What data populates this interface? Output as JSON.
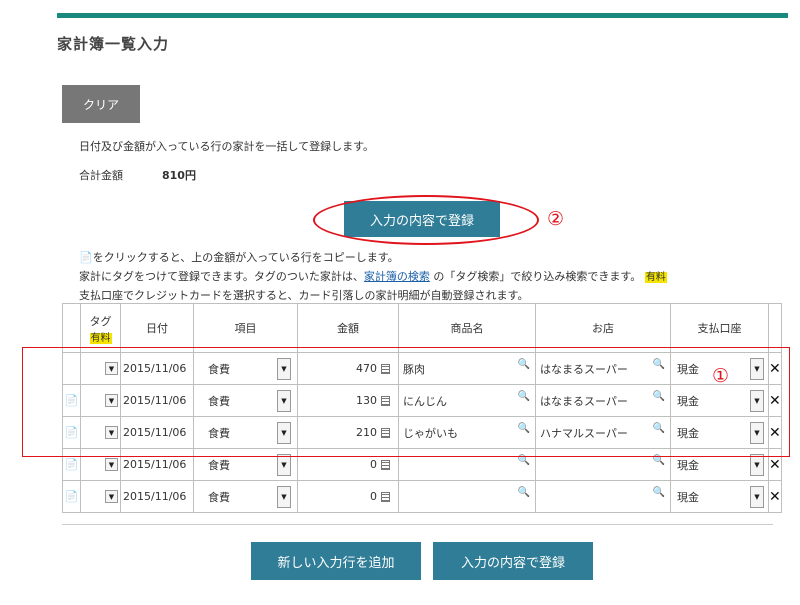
{
  "page": {
    "title": "家計簿一覧入力"
  },
  "buttons": {
    "clear": "クリア",
    "register": "入力の内容で登録",
    "add_row": "新しい入力行を追加",
    "register_bottom": "入力の内容で登録"
  },
  "info": {
    "bulk_note": "日付及び金額が入っている行の家計を一括して登録します。",
    "total_label": "合計金額",
    "total_value": "810円"
  },
  "notes": {
    "copy_note": "をクリックすると、上の金額が入っている行をコピーします。",
    "tag_note_prefix": "家計にタグをつけて登録できます。タグのついた家計は、",
    "tag_note_link": "家計簿の検索",
    "tag_note_suffix": " の「タグ検索」で絞り込み検索できます。",
    "paid_badge": "有料",
    "card_note": "支払口座でクレジットカードを選択すると、カード引落しの家計明細が自動登録されます。"
  },
  "annotations": {
    "marker1": "①",
    "marker2": "②"
  },
  "table": {
    "headers": {
      "tag": "タグ",
      "tag_badge": "有料",
      "date": "日付",
      "item": "項目",
      "amount": "金額",
      "product": "商品名",
      "shop": "お店",
      "account": "支払口座"
    },
    "rows": [
      {
        "date": "2015/11/06",
        "item": "食費",
        "amount": "470",
        "product": "豚肉",
        "shop": "はなまるスーパー",
        "account": "現金"
      },
      {
        "date": "2015/11/06",
        "item": "食費",
        "amount": "130",
        "product": "にんじん",
        "shop": "はなまるスーパー",
        "account": "現金"
      },
      {
        "date": "2015/11/06",
        "item": "食費",
        "amount": "210",
        "product": "じゃがいも",
        "shop": "ハナマルスーパー",
        "account": "現金"
      },
      {
        "date": "2015/11/06",
        "item": "食費",
        "amount": "0",
        "product": "",
        "shop": "",
        "account": "現金"
      },
      {
        "date": "2015/11/06",
        "item": "食費",
        "amount": "0",
        "product": "",
        "shop": "",
        "account": "現金"
      }
    ]
  },
  "colors": {
    "accent": "#1b8a7e",
    "button": "#2f7d96",
    "highlight_red": "#e0141b",
    "badge": "#f5e400"
  }
}
